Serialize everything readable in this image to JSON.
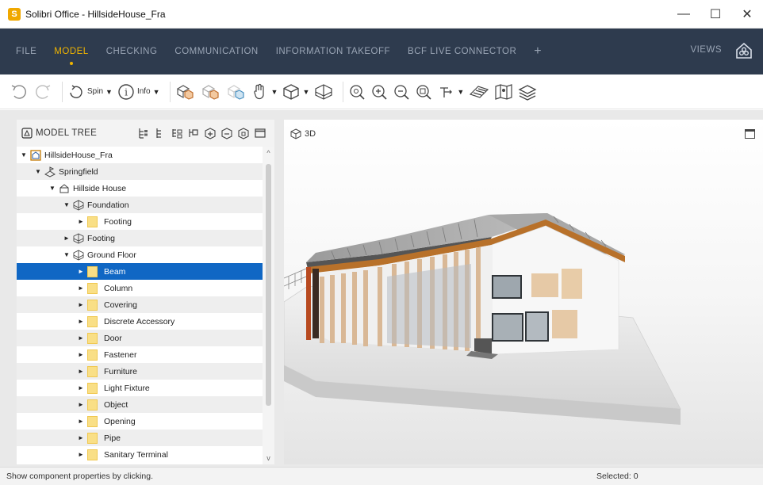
{
  "window": {
    "app_icon_letter": "S",
    "title": "Solibri Office - HillsideHouse_Fra",
    "minimize": "—",
    "maximize": "☐",
    "close": "✕"
  },
  "menu": {
    "items": [
      {
        "label": "FILE",
        "active": false
      },
      {
        "label": "MODEL",
        "active": true
      },
      {
        "label": "CHECKING",
        "active": false
      },
      {
        "label": "COMMUNICATION",
        "active": false
      },
      {
        "label": "INFORMATION TAKEOFF",
        "active": false
      },
      {
        "label": "BCF LIVE CONNECTOR",
        "active": false
      }
    ],
    "add_label": "+",
    "views_label": "VIEWS",
    "accent_color": "#f0b400",
    "background": "#2e3b4e"
  },
  "toolbar": {
    "spin_label": "Spin",
    "info_label": "Info",
    "info_glyph": "i"
  },
  "tree": {
    "title": "MODEL TREE",
    "rows": [
      {
        "label": "HillsideHouse_Fra",
        "toggle": "▼",
        "type": "project"
      },
      {
        "label": "Springfield",
        "toggle": "▼",
        "type": "site"
      },
      {
        "label": "Hillside House",
        "toggle": "▼",
        "type": "building"
      },
      {
        "label": "Foundation",
        "toggle": "▼",
        "type": "storey"
      },
      {
        "label": "Footing",
        "toggle": "►",
        "type": "folder"
      },
      {
        "label": "Footing",
        "toggle": "►",
        "type": "storey"
      },
      {
        "label": "Ground Floor",
        "toggle": "▼",
        "type": "storey"
      },
      {
        "label": "Beam",
        "toggle": "►",
        "type": "folder"
      },
      {
        "label": "Column",
        "toggle": "►",
        "type": "folder"
      },
      {
        "label": "Covering",
        "toggle": "►",
        "type": "folder"
      },
      {
        "label": "Discrete Accessory",
        "toggle": "►",
        "type": "folder"
      },
      {
        "label": "Door",
        "toggle": "►",
        "type": "folder"
      },
      {
        "label": "Fastener",
        "toggle": "►",
        "type": "folder"
      },
      {
        "label": "Furniture",
        "toggle": "►",
        "type": "folder"
      },
      {
        "label": "Light Fixture",
        "toggle": "►",
        "type": "folder"
      },
      {
        "label": "Object",
        "toggle": "►",
        "type": "folder"
      },
      {
        "label": "Opening",
        "toggle": "►",
        "type": "folder"
      },
      {
        "label": "Pipe",
        "toggle": "►",
        "type": "folder"
      },
      {
        "label": "Sanitary Terminal",
        "toggle": "►",
        "type": "folder"
      }
    ],
    "selected_label": "Beam",
    "scroll_up": "^",
    "scroll_down": "v"
  },
  "view": {
    "label": "3D"
  },
  "status": {
    "hint": "Show component properties by clicking.",
    "selected": "Selected: 0"
  }
}
